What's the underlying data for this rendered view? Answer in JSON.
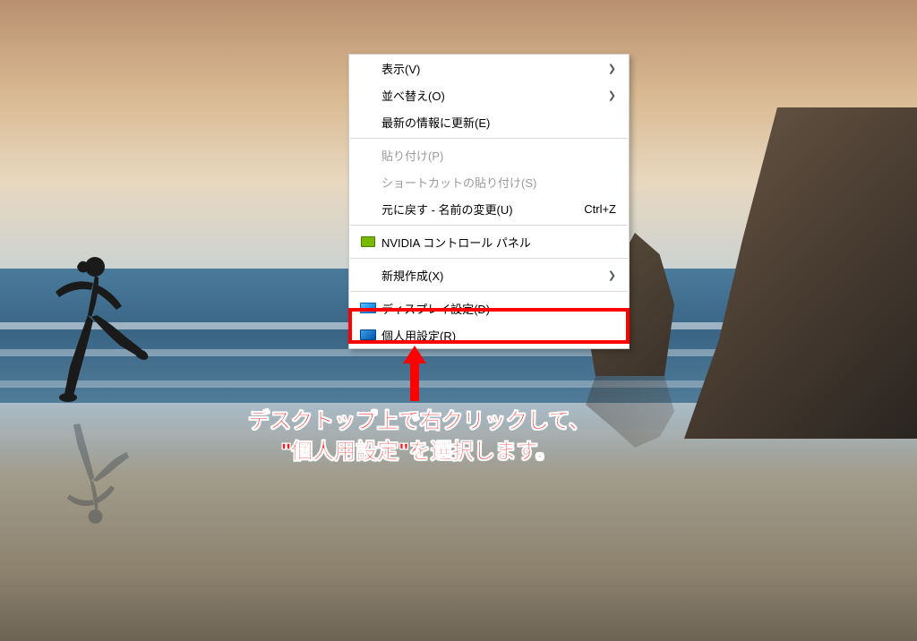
{
  "context_menu": {
    "items": [
      {
        "label": "表示(V)",
        "has_submenu": true
      },
      {
        "label": "並べ替え(O)",
        "has_submenu": true
      },
      {
        "label": "最新の情報に更新(E)"
      },
      {
        "separator": true
      },
      {
        "label": "貼り付け(P)",
        "disabled": true
      },
      {
        "label": "ショートカットの貼り付け(S)",
        "disabled": true
      },
      {
        "label": "元に戻す - 名前の変更(U)",
        "shortcut": "Ctrl+Z"
      },
      {
        "separator": true
      },
      {
        "label": "NVIDIA コントロール パネル",
        "icon": "nvidia-icon"
      },
      {
        "separator": true
      },
      {
        "label": "新規作成(X)",
        "has_submenu": true
      },
      {
        "separator": true
      },
      {
        "label": "ディスプレイ設定(D)",
        "icon": "display-icon"
      },
      {
        "label": "個人用設定(R)",
        "icon": "personalize-icon",
        "highlighted": true
      }
    ]
  },
  "annotation": {
    "line1": "デスクトップ上で右クリックして、",
    "line2": "\"個人用設定\"を選択します。"
  },
  "colors": {
    "highlight": "#ff0000",
    "callout_text": "#ff1a1a"
  }
}
